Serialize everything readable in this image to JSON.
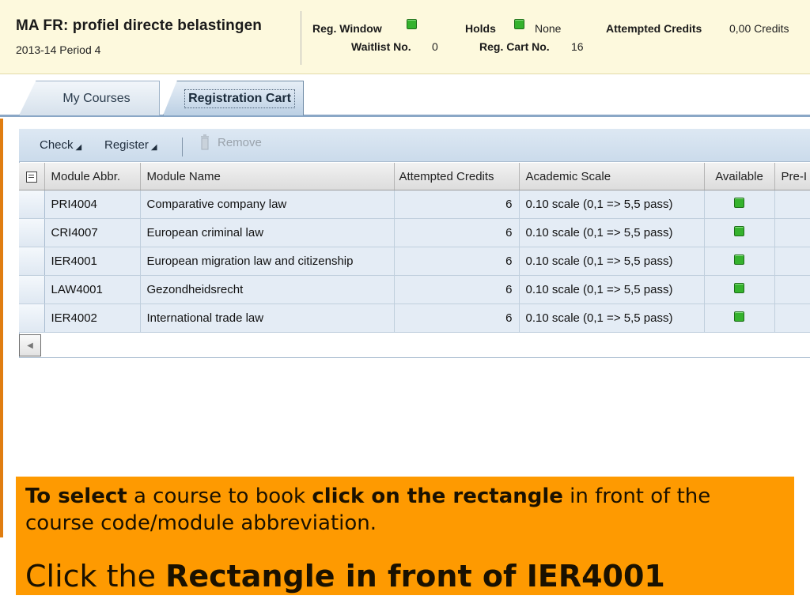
{
  "header": {
    "program_title": "MA FR: profiel directe belastingen",
    "period": "2013-14 Period 4",
    "reg_window_label": "Reg. Window",
    "holds_label": "Holds",
    "holds_value": "None",
    "attempted_credits_label": "Attempted Credits",
    "attempted_credits_value": "0,00 Credits",
    "waitlist_label": "Waitlist No.",
    "waitlist_value": "0",
    "reg_cart_label": "Reg. Cart No.",
    "reg_cart_value": "16"
  },
  "tabs": [
    {
      "label": "My Courses",
      "active": false
    },
    {
      "label": "Registration Cart",
      "active": true
    }
  ],
  "toolbar": {
    "check_label": "Check",
    "register_label": "Register",
    "remove_label": "Remove"
  },
  "table": {
    "columns": [
      "Module Abbr.",
      "Module Name",
      "Attempted Credits",
      "Academic Scale",
      "Available",
      "Pre-I"
    ],
    "rows": [
      {
        "abbr": "PRI4004",
        "name": "Comparative company law",
        "credits": "6",
        "scale": "0.10 scale (0,1 => 5,5 pass)",
        "available": true
      },
      {
        "abbr": "CRI4007",
        "name": "European criminal law",
        "credits": "6",
        "scale": "0.10 scale (0,1 => 5,5 pass)",
        "available": true
      },
      {
        "abbr": "IER4001",
        "name": "European migration law and citizenship",
        "credits": "6",
        "scale": "0.10 scale (0,1 => 5,5 pass)",
        "available": true
      },
      {
        "abbr": "LAW4001",
        "name": "Gezondheidsrecht",
        "credits": "6",
        "scale": "0.10 scale (0,1 => 5,5 pass)",
        "available": true
      },
      {
        "abbr": "IER4002",
        "name": "International trade law",
        "credits": "6",
        "scale": "0.10 scale (0,1 => 5,5 pass)",
        "available": true
      }
    ]
  },
  "instructions": {
    "line1_bold_a": "To select",
    "line1_text_a": " a course to book ",
    "line1_bold_b": "click on the rectangle",
    "line1_text_b": " in front of the course code/module abbreviation.",
    "line2_text": "Click the ",
    "line2_bold": "Rectangle in front of IER4001"
  },
  "colors": {
    "status_green": "#35b22d",
    "instruction_bg": "#fe9a01",
    "header_bg": "#fdf9dd"
  },
  "icons": [
    "status-green-icon",
    "trash-icon",
    "table-settings-icon",
    "scroll-left-icon",
    "dropdown-triangle-icon"
  ]
}
